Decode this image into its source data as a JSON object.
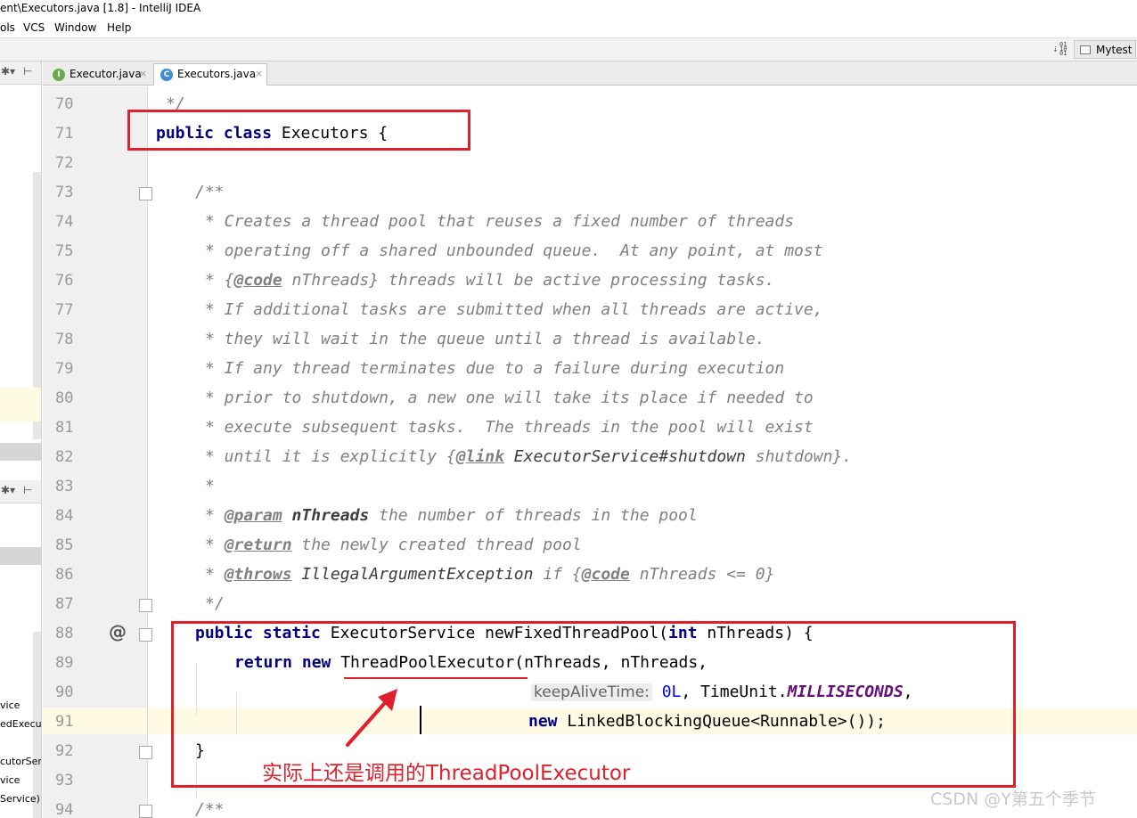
{
  "window": {
    "title": "ent\\Executors.java [1.8] - IntelliJ IDEA"
  },
  "menu": {
    "items": [
      "ols",
      "VCS",
      "Window",
      "Help"
    ]
  },
  "toolbar": {
    "vcs_icon": "vcs-update-icon",
    "run_config": "Mytest"
  },
  "left_panel": {
    "gear_glyph": "✱▾",
    "pin_glyph": "⊢",
    "fragments": [
      "vice",
      "edExecut",
      "cutorServ",
      "vice",
      "Service):"
    ]
  },
  "tabs": [
    {
      "label": "Executor.java",
      "icon": "I",
      "close": "×",
      "active": false
    },
    {
      "label": "Executors.java",
      "icon": "C",
      "close": "×",
      "active": true
    }
  ],
  "editor": {
    "line_numbers": [
      "70",
      "71",
      "72",
      "73",
      "74",
      "75",
      "76",
      "77",
      "78",
      "79",
      "80",
      "81",
      "82",
      "83",
      "84",
      "85",
      "86",
      "87",
      "88",
      "89",
      "90",
      "91",
      "92",
      "93",
      "94"
    ],
    "override_marker": "@",
    "lines": {
      "l70": "*/",
      "l71": {
        "kw": "public class",
        "name": " Executors {"
      },
      "l73": "/**",
      "l74": "* Creates a thread pool that reuses a fixed number of threads",
      "l75": "* operating off a shared unbounded queue.  At any point, at most",
      "l76": {
        "a": "* {",
        "tag": "@code",
        "b": " nThreads} threads will be active processing tasks."
      },
      "l77": "* If additional tasks are submitted when all threads are active,",
      "l78": "* they will wait in the queue until a thread is available.",
      "l79": "* If any thread terminates due to a failure during execution",
      "l80": "* prior to shutdown, a new one will take its place if needed to",
      "l81": "* execute subsequent tasks.  The threads in the pool will exist",
      "l82": {
        "a": "* until it is explicitly {",
        "tag": "@link",
        "ref": " ExecutorService#shutdown",
        "b": " shutdown}."
      },
      "l83": "*",
      "l84": {
        "a": "* ",
        "tag": "@param",
        "val": " nThreads",
        "b": " the number of threads in the pool"
      },
      "l85": {
        "a": "* ",
        "tag": "@return",
        "b": " the newly created thread pool"
      },
      "l86": {
        "a": "* ",
        "tag": "@throws",
        "ref": " IllegalArgumentException",
        "b": " if {",
        "tag2": "@code",
        "c": " nThreads <= 0}"
      },
      "l87": "*/",
      "l88": {
        "kw": "public static",
        "a": " ExecutorService newFixedThreadPool(",
        "kw2": "int",
        "b": " nThreads) {"
      },
      "l89": {
        "kw": "return new",
        "a": " ThreadPoolExecutor(nThreads, nThreads,"
      },
      "l90": {
        "hint": "keepAliveTime:",
        "num": " 0L",
        "a": ", TimeUnit.",
        "st": "MILLISECONDS",
        "b": ","
      },
      "l91": {
        "kw": "new",
        "a": " LinkedBlockingQueue<Runnable>());"
      },
      "l92": "}",
      "l94": "/**"
    }
  },
  "annotation": {
    "text": "实际上还是调用的ThreadPoolExecutor",
    "color": "#e0202a"
  },
  "watermark": "CSDN @Y第五个季节"
}
